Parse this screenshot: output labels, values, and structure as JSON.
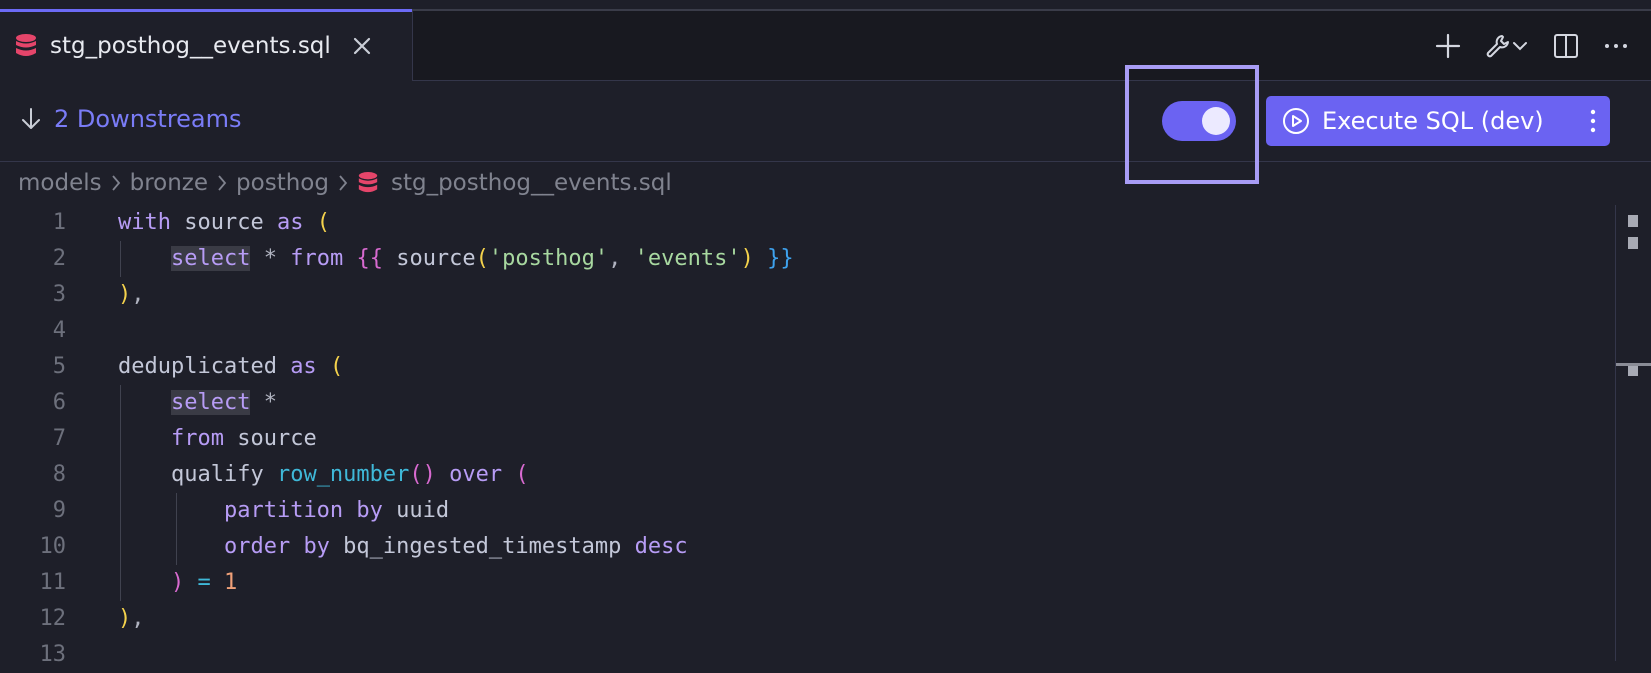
{
  "tab": {
    "title": "stg_posthog__events.sql",
    "icon": "database-icon",
    "close_icon": "close-icon"
  },
  "tab_actions": [
    "plus-icon",
    "wrench-icon",
    "chevron-down-icon",
    "split-editor-icon",
    "more-horizontal-icon"
  ],
  "toolbar": {
    "downstreams_label": "2 Downstreams",
    "toggle_on": true,
    "execute_label": "Execute SQL (dev)"
  },
  "breadcrumb": [
    "models",
    "bronze",
    "posthog",
    "stg_posthog__events.sql"
  ],
  "editor": {
    "line_numbers": [
      "1",
      "2",
      "3",
      "4",
      "5",
      "6",
      "7",
      "8",
      "9",
      "10",
      "11",
      "12",
      "13"
    ],
    "lines": [
      [
        {
          "t": "with",
          "c": "kw"
        },
        {
          "t": " source ",
          "c": "id"
        },
        {
          "t": "as",
          "c": "kw"
        },
        {
          "t": " ",
          "c": "id"
        },
        {
          "t": "(",
          "c": "p1"
        }
      ],
      [
        {
          "t": "    ",
          "c": "id"
        },
        {
          "t": "select",
          "c": "kw hl"
        },
        {
          "t": " * ",
          "c": "op"
        },
        {
          "t": "from",
          "c": "kw"
        },
        {
          "t": " ",
          "c": "id"
        },
        {
          "t": "{{",
          "c": "p2"
        },
        {
          "t": " source",
          "c": "id"
        },
        {
          "t": "(",
          "c": "p1"
        },
        {
          "t": "'posthog'",
          "c": "str"
        },
        {
          "t": ", ",
          "c": "op"
        },
        {
          "t": "'events'",
          "c": "str"
        },
        {
          "t": ")",
          "c": "p1"
        },
        {
          "t": " ",
          "c": "id"
        },
        {
          "t": "}}",
          "c": "p3"
        }
      ],
      [
        {
          "t": ")",
          "c": "p1"
        },
        {
          "t": ",",
          "c": "op"
        }
      ],
      [],
      [
        {
          "t": "deduplicated ",
          "c": "id"
        },
        {
          "t": "as",
          "c": "kw"
        },
        {
          "t": " ",
          "c": "id"
        },
        {
          "t": "(",
          "c": "p1"
        }
      ],
      [
        {
          "t": "    ",
          "c": "id"
        },
        {
          "t": "select",
          "c": "kw hl"
        },
        {
          "t": " *",
          "c": "op"
        }
      ],
      [
        {
          "t": "    ",
          "c": "id"
        },
        {
          "t": "from",
          "c": "kw"
        },
        {
          "t": " source",
          "c": "id"
        }
      ],
      [
        {
          "t": "    ",
          "c": "id"
        },
        {
          "t": "qualify ",
          "c": "id"
        },
        {
          "t": "row_number",
          "c": "fn"
        },
        {
          "t": "()",
          "c": "p2"
        },
        {
          "t": " ",
          "c": "id"
        },
        {
          "t": "over",
          "c": "kw"
        },
        {
          "t": " ",
          "c": "id"
        },
        {
          "t": "(",
          "c": "p2"
        }
      ],
      [
        {
          "t": "        ",
          "c": "id"
        },
        {
          "t": "partition by",
          "c": "kw"
        },
        {
          "t": " uuid",
          "c": "id"
        }
      ],
      [
        {
          "t": "        ",
          "c": "id"
        },
        {
          "t": "order by",
          "c": "kw"
        },
        {
          "t": " bq_ingested_timestamp ",
          "c": "id"
        },
        {
          "t": "desc",
          "c": "kw"
        }
      ],
      [
        {
          "t": "    ",
          "c": "id"
        },
        {
          "t": ")",
          "c": "p2"
        },
        {
          "t": " = ",
          "c": "fn"
        },
        {
          "t": "1",
          "c": "num"
        }
      ],
      [
        {
          "t": ")",
          "c": "p1"
        },
        {
          "t": ",",
          "c": "op"
        }
      ],
      []
    ]
  },
  "colors": {
    "accent": "#6b63f2",
    "highlight_box": "#a89cf5",
    "background": "#1e1f29",
    "database_icon": "#e5456a"
  }
}
